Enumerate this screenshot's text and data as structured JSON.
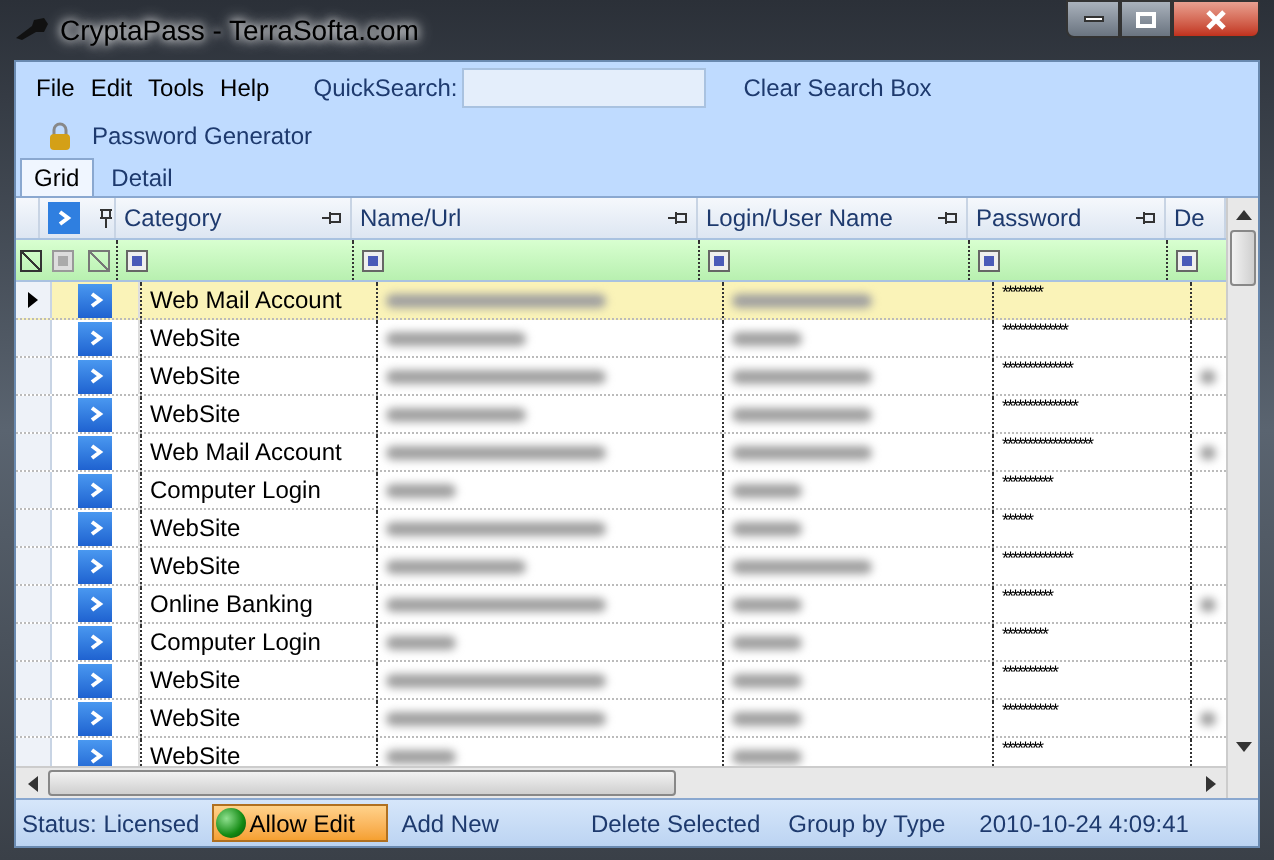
{
  "window": {
    "title": "CryptaPass - TerraSofta.com"
  },
  "menu": [
    "File",
    "Edit",
    "Tools",
    "Help"
  ],
  "quick_search": {
    "label": "QuickSearch:"
  },
  "clear_search": "Clear Search Box",
  "toolbar": {
    "label": "Password Generator"
  },
  "tabs": [
    {
      "label": "Grid",
      "selected": true
    },
    {
      "label": "Detail",
      "selected": false
    }
  ],
  "grid": {
    "columns": [
      "Category",
      "Name/Url",
      "Login/User Name",
      "Password",
      "De"
    ],
    "rows": [
      {
        "category": "Web Mail Account",
        "password": "********",
        "selected": true
      },
      {
        "category": "WebSite",
        "password": "*************",
        "selected": false
      },
      {
        "category": "WebSite",
        "password": "**************",
        "selected": false
      },
      {
        "category": "WebSite",
        "password": "***************",
        "selected": false
      },
      {
        "category": "Web Mail Account",
        "password": "******************",
        "selected": false
      },
      {
        "category": "Computer Login",
        "password": "**********",
        "selected": false
      },
      {
        "category": "WebSite",
        "password": "******",
        "selected": false
      },
      {
        "category": "WebSite",
        "password": "**************",
        "selected": false
      },
      {
        "category": "Online Banking",
        "password": "**********",
        "selected": false
      },
      {
        "category": "Computer Login",
        "password": "*********",
        "selected": false
      },
      {
        "category": "WebSite",
        "password": "***********",
        "selected": false
      },
      {
        "category": "WebSite",
        "password": "***********",
        "selected": false
      },
      {
        "category": "WebSite",
        "password": "********",
        "selected": false
      }
    ]
  },
  "status_bar": {
    "status": "Status: Licensed",
    "allow_edit": {
      "label": "Allow Edit",
      "on": true
    },
    "actions": [
      "Add New",
      "Delete Selected",
      "Group by Type"
    ],
    "timestamp": "2010-10-24 4:09:41"
  }
}
